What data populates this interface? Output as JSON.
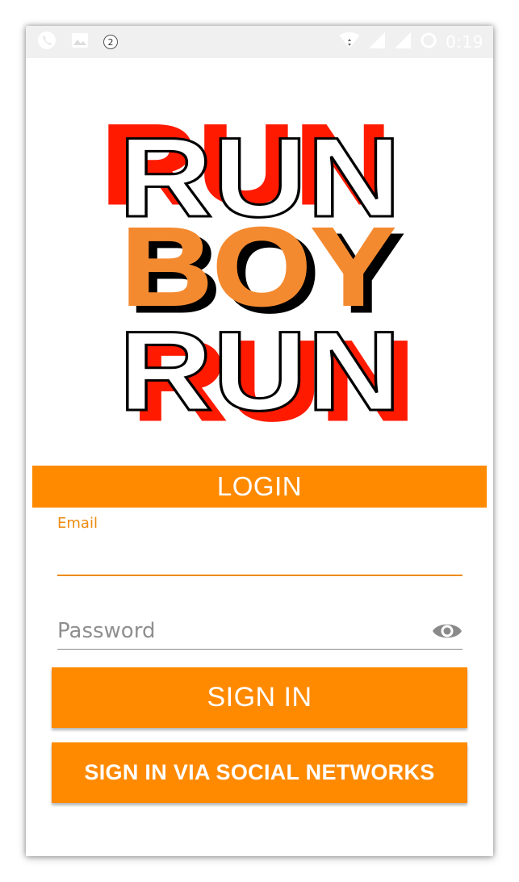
{
  "status_bar": {
    "time": "0:19",
    "notification_count": "2",
    "icons_left": [
      "phone-icon",
      "image-icon",
      "notification-badge"
    ],
    "icons_right": [
      "wifi-icon",
      "signal-icon",
      "signal-icon",
      "loading-icon"
    ]
  },
  "logo": {
    "lines": [
      "RUN",
      "BOY",
      "RUN"
    ],
    "colors": {
      "outline": "#000000",
      "shadow_red": "#ff1a00",
      "orange": "#f48a30",
      "fill": "#ffffff"
    }
  },
  "header": {
    "title": "LOGIN"
  },
  "form": {
    "email_label": "Email",
    "email_value": "",
    "password_placeholder": "Password",
    "password_value": ""
  },
  "buttons": {
    "sign_in": "SIGN IN",
    "social": "SIGN IN VIA SOCIAL NETWORKS"
  },
  "theme": {
    "accent": "#ff8a00",
    "status_bar_bg": "#f0f0f0"
  }
}
